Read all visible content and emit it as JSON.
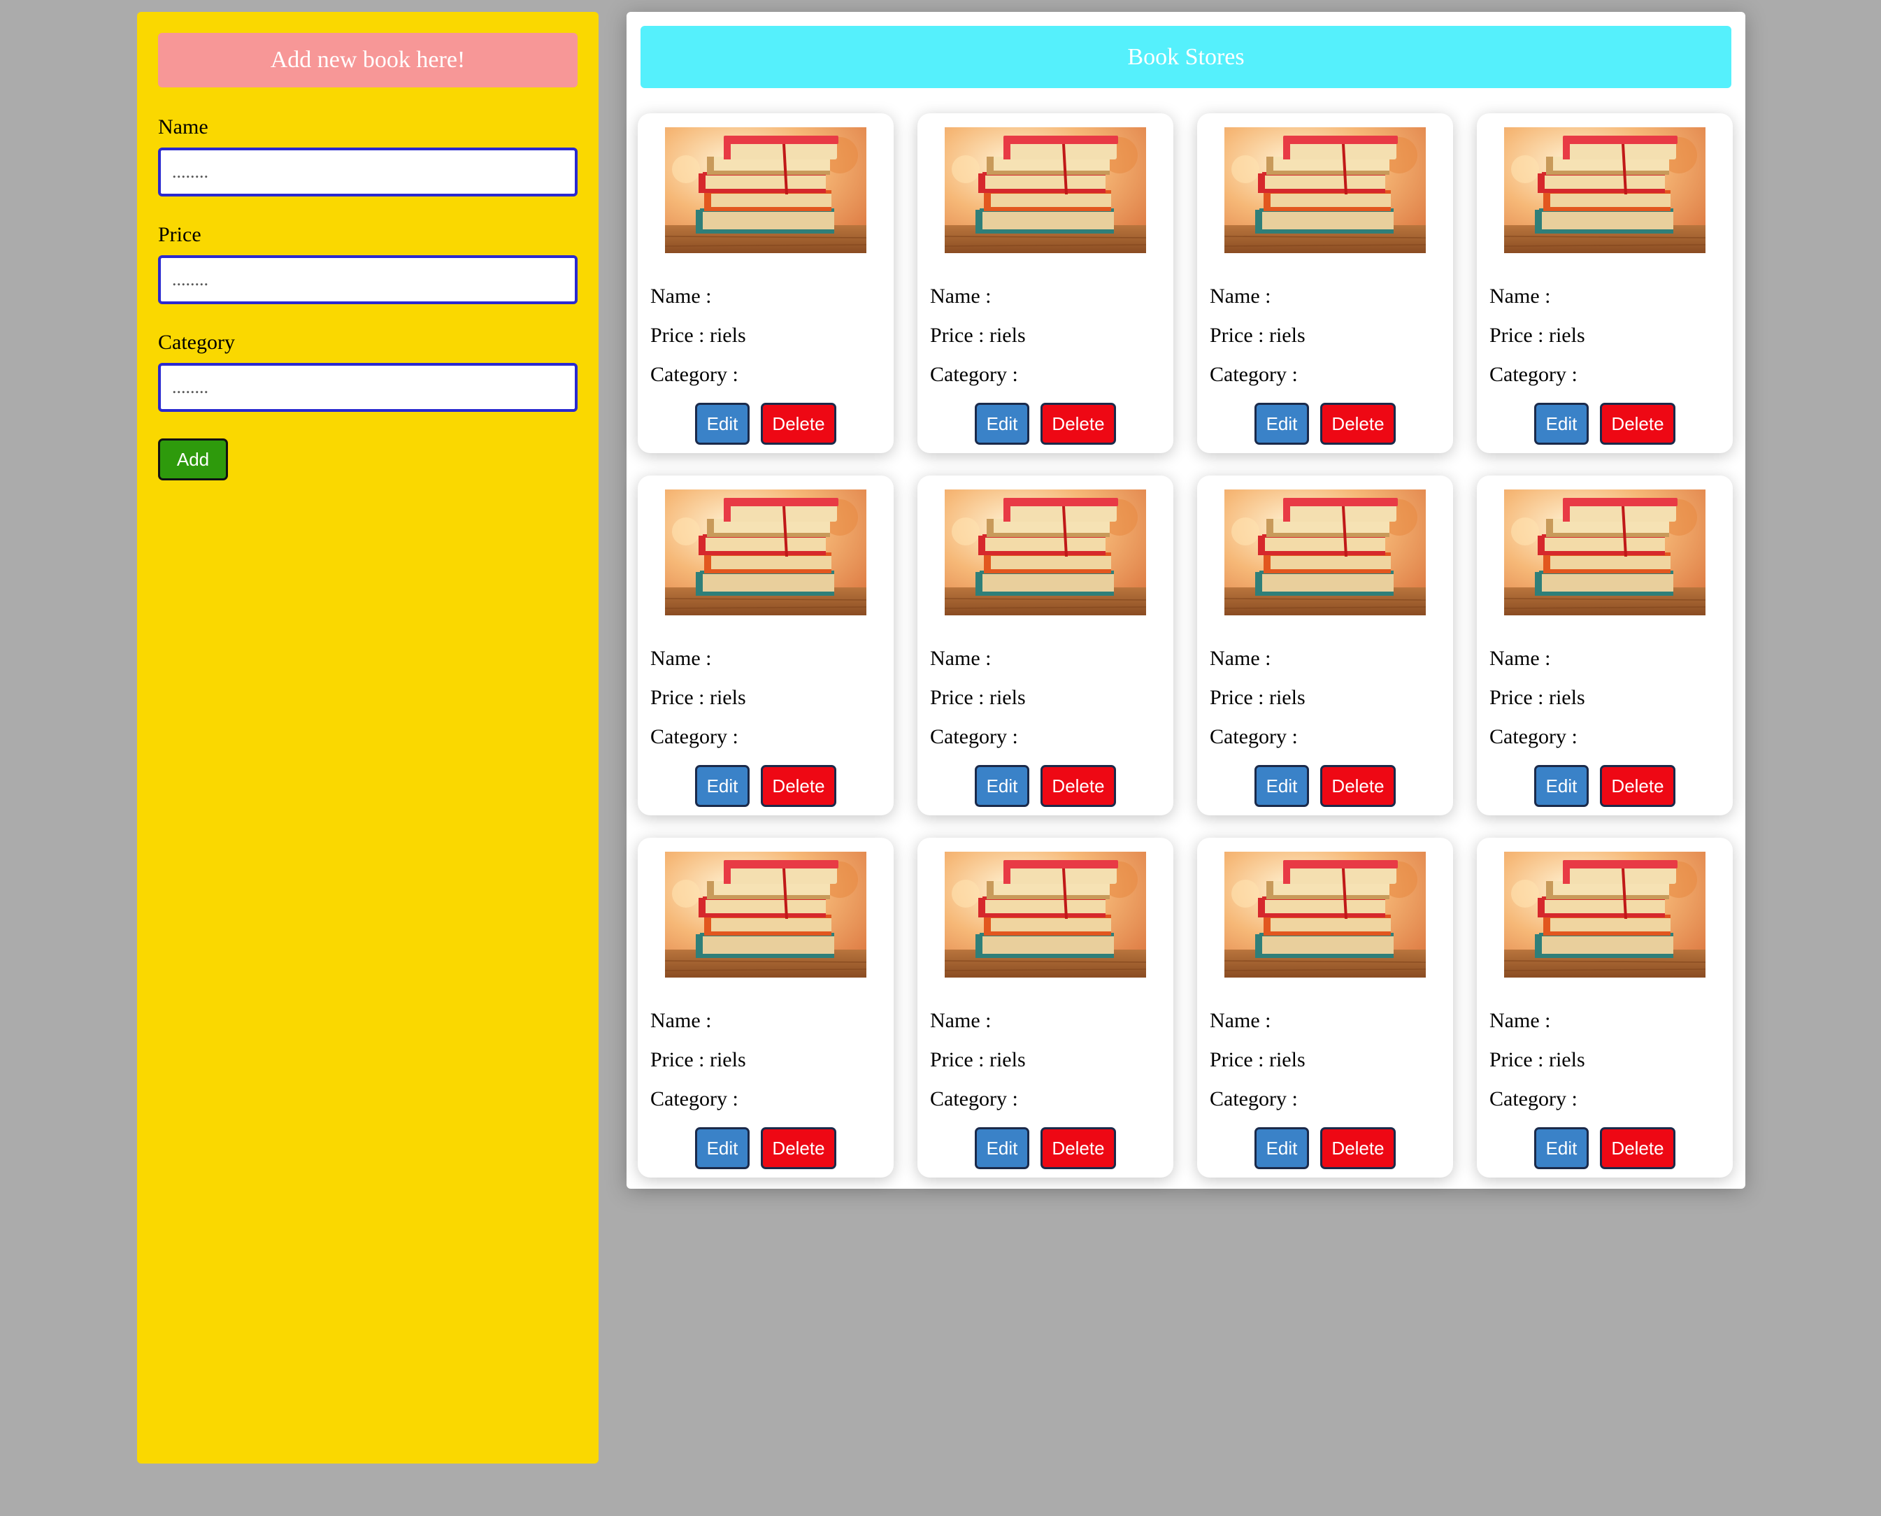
{
  "form": {
    "header": "Add new book here!",
    "fields": [
      {
        "label": "Name",
        "placeholder": "........",
        "value": ""
      },
      {
        "label": "Price",
        "placeholder": "........",
        "value": ""
      },
      {
        "label": "Category",
        "placeholder": "........",
        "value": ""
      }
    ],
    "add_label": "Add"
  },
  "store": {
    "header": "Book Stores",
    "books": [
      {
        "name": "Name : ",
        "price": "Price : riels",
        "category": "Category : ",
        "image": "book-stack-image",
        "edit_label": "Edit",
        "delete_label": "Delete"
      },
      {
        "name": "Name : ",
        "price": "Price : riels",
        "category": "Category : ",
        "image": "book-stack-image",
        "edit_label": "Edit",
        "delete_label": "Delete"
      },
      {
        "name": "Name : ",
        "price": "Price : riels",
        "category": "Category : ",
        "image": "book-stack-image",
        "edit_label": "Edit",
        "delete_label": "Delete"
      },
      {
        "name": "Name : ",
        "price": "Price : riels",
        "category": "Category : ",
        "image": "book-stack-image",
        "edit_label": "Edit",
        "delete_label": "Delete"
      },
      {
        "name": "Name : ",
        "price": "Price : riels",
        "category": "Category : ",
        "image": "book-stack-image",
        "edit_label": "Edit",
        "delete_label": "Delete"
      },
      {
        "name": "Name : ",
        "price": "Price : riels",
        "category": "Category : ",
        "image": "book-stack-image",
        "edit_label": "Edit",
        "delete_label": "Delete"
      },
      {
        "name": "Name : ",
        "price": "Price : riels",
        "category": "Category : ",
        "image": "book-stack-image",
        "edit_label": "Edit",
        "delete_label": "Delete"
      },
      {
        "name": "Name : ",
        "price": "Price : riels",
        "category": "Category : ",
        "image": "book-stack-image",
        "edit_label": "Edit",
        "delete_label": "Delete"
      },
      {
        "name": "Name : ",
        "price": "Price : riels",
        "category": "Category : ",
        "image": "book-stack-image",
        "edit_label": "Edit",
        "delete_label": "Delete"
      },
      {
        "name": "Name : ",
        "price": "Price : riels",
        "category": "Category : ",
        "image": "book-stack-image",
        "edit_label": "Edit",
        "delete_label": "Delete"
      },
      {
        "name": "Name : ",
        "price": "Price : riels",
        "category": "Category : ",
        "image": "book-stack-image",
        "edit_label": "Edit",
        "delete_label": "Delete"
      },
      {
        "name": "Name : ",
        "price": "Price : riels",
        "category": "Category : ",
        "image": "book-stack-image",
        "edit_label": "Edit",
        "delete_label": "Delete"
      }
    ]
  },
  "colors": {
    "page_bg": "#ababab",
    "sidebar_bg": "#fad800",
    "form_header_bg": "#f79797",
    "store_header_bg": "#55f0fc",
    "input_border": "#2a2ad0",
    "add_button": "#2e9a0c",
    "edit_button": "#3a82c8",
    "delete_button": "#ee0814"
  }
}
